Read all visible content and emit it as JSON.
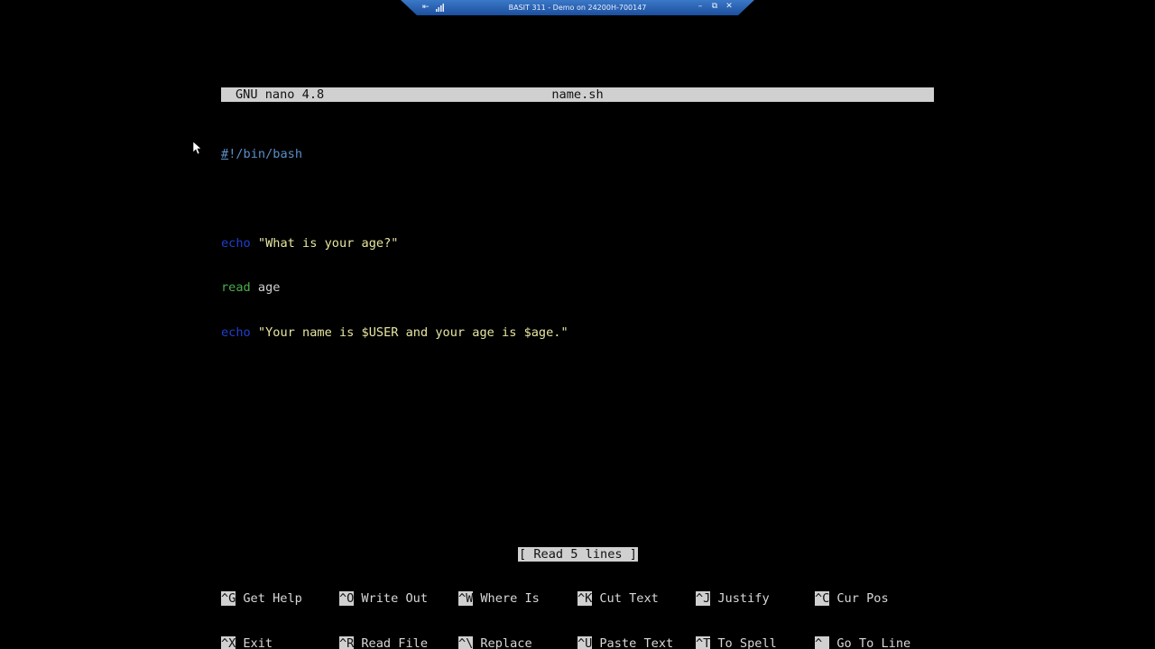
{
  "remote_bar": {
    "title": "BASIT 311 - Demo on 24200H-700147",
    "pin_icon": "pin-icon",
    "signal_icon": "signal-icon",
    "minimize": "–",
    "restore": "⧉",
    "close": "✕",
    "accent": "#2a64b8"
  },
  "nano": {
    "version": "GNU nano 4.8",
    "filename": "name.sh",
    "lines": {
      "l1_cursor": "#",
      "l1_rest": "!/bin/bash",
      "l3_kw": "echo",
      "l3_str": " \"What is your age?\"",
      "l4_kw": "read",
      "l4_rest": " age",
      "l5_kw": "echo",
      "l5_str": " \"Your name is $USER and your age is $age.\""
    },
    "status": "[ Read 5 lines ]",
    "shortcuts": {
      "row1": [
        {
          "key": "^G",
          "label": "Get Help"
        },
        {
          "key": "^O",
          "label": "Write Out"
        },
        {
          "key": "^W",
          "label": "Where Is"
        },
        {
          "key": "^K",
          "label": "Cut Text"
        },
        {
          "key": "^J",
          "label": "Justify"
        },
        {
          "key": "^C",
          "label": "Cur Pos"
        }
      ],
      "row2": [
        {
          "key": "^X",
          "label": "Exit"
        },
        {
          "key": "^R",
          "label": "Read File"
        },
        {
          "key": "^\\",
          "label": "Replace"
        },
        {
          "key": "^U",
          "label": "Paste Text"
        },
        {
          "key": "^T",
          "label": "To Spell"
        },
        {
          "key": "^_",
          "label": "Go To Line"
        }
      ]
    }
  }
}
